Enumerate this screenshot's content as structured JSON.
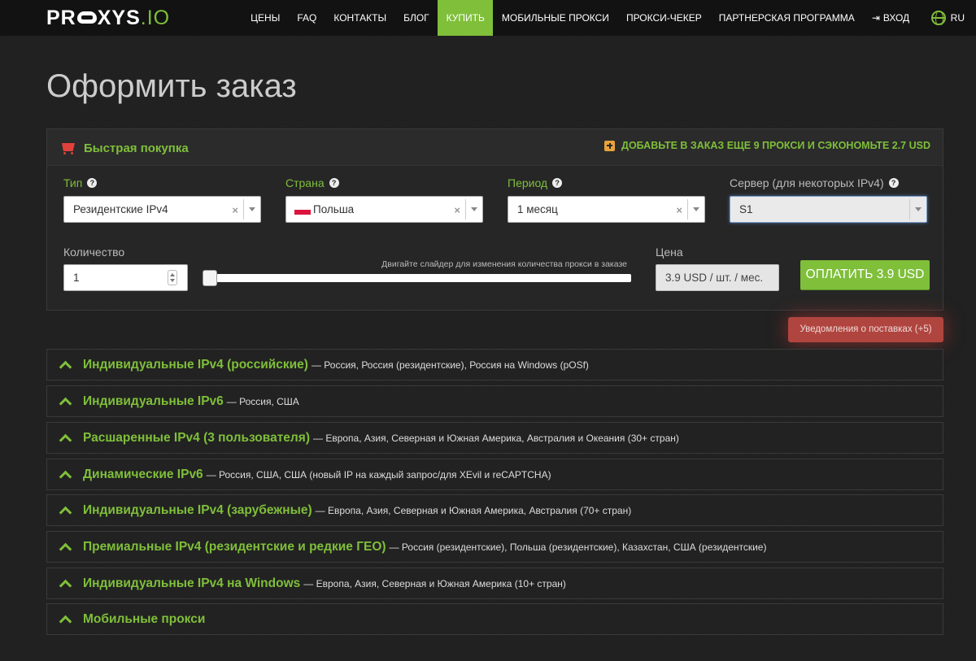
{
  "brand": {
    "logo_part1": "PR",
    "logo_part2": "XYS",
    "logo_part3": ".IO"
  },
  "nav": {
    "items": [
      "ЦЕНЫ",
      "FAQ",
      "КОНТАКТЫ",
      "БЛОГ",
      "КУПИТЬ",
      "МОБИЛЬНЫЕ ПРОКСИ",
      "ПРОКСИ-ЧЕКЕР",
      "ПАРТНЕРСКАЯ ПРОГРАММА"
    ],
    "active_index": 4,
    "login": "ВХОД",
    "lang": "RU"
  },
  "page": {
    "title": "Оформить заказ"
  },
  "quick_buy": {
    "title": "Быстрая покупка",
    "promo": "ДОБАВЬТЕ В ЗАКАЗ ЕЩЕ 9 ПРОКСИ И СЭКОНОМЬТЕ 2.7 USD",
    "fields": {
      "type": {
        "label": "Тип",
        "value": "Резидентские IPv4"
      },
      "country": {
        "label": "Страна",
        "value": "Польша"
      },
      "period": {
        "label": "Период",
        "value": "1 месяц"
      },
      "server": {
        "label": "Сервер (для некоторых IPv4)",
        "value": "S1"
      }
    },
    "quantity_label": "Количество",
    "quantity_value": "1",
    "slider_hint": "Двигайте слайдер для изменения количества прокси в заказе",
    "price_label": "Цена",
    "price_value": "3.9 USD / шт. / мес.",
    "pay_button": "ОПЛАТИТЬ 3.9 USD"
  },
  "notifications": "Уведомления о поставках (+5)",
  "categories": [
    {
      "title": "Индивидуальные IPv4 (российские)",
      "subtitle": "— Россия, Россия (резидентские), Россия на Windows (pOSf)"
    },
    {
      "title": "Индивидуальные IPv6",
      "subtitle": "— Россия, США"
    },
    {
      "title": "Расшаренные IPv4 (3 пользователя)",
      "subtitle": "— Европа, Азия, Северная и Южная Америка, Австралия и Океания (30+ стран)"
    },
    {
      "title": "Динамические IPv6",
      "subtitle": "— Россия, США, США (новый IP на каждый запрос/для XEvil и reCAPTCHA)"
    },
    {
      "title": "Индивидуальные IPv4 (зарубежные)",
      "subtitle": "— Европа, Азия, Северная и Южная Америка, Австралия (70+ стран)"
    },
    {
      "title": "Премиальные IPv4 (резидентские и редкие ГЕО)",
      "subtitle": "— Россия (резидентские), Польша (резидентские), Казахстан, США (резидентские)"
    },
    {
      "title": "Индивидуальные IPv4 на Windows",
      "subtitle": "— Европа, Азия, Северная и Южная Америка (10+ стран)"
    },
    {
      "title": "Мобильные прокси",
      "subtitle": ""
    }
  ],
  "colors": {
    "accent": "#7fbf3a",
    "alert": "#b0453f",
    "background": "#1f1f1f"
  },
  "icons": [
    "cart-icon",
    "plus-icon",
    "question-icon",
    "clear-icon",
    "chevron-down-icon",
    "chevron-up-icon",
    "login-icon",
    "globe-icon",
    "flag-poland-icon"
  ]
}
